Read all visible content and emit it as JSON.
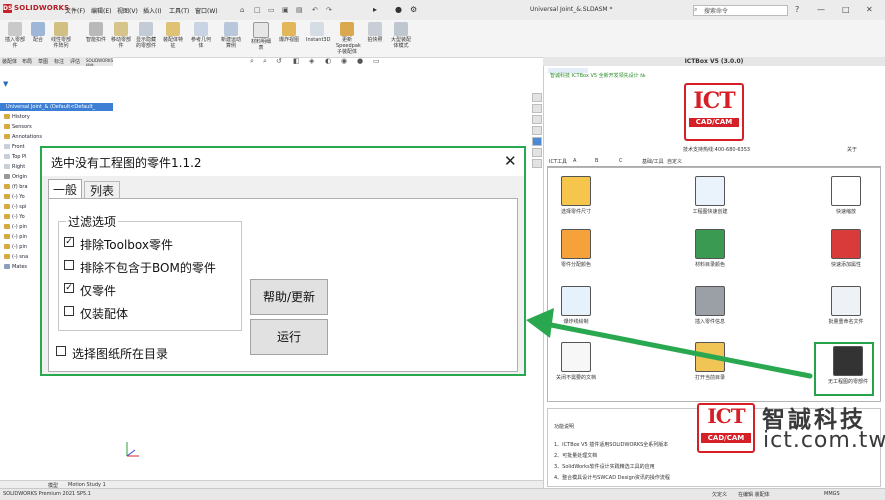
{
  "app": {
    "logo_text": "SOLIDWORKS",
    "menus": [
      "文件(F)",
      "编辑(E)",
      "视图(V)",
      "插入(I)",
      "工具(T)",
      "窗口(W)"
    ],
    "document_title": "Universal Joint_&.SLDASM *",
    "search_placeholder": "搜索命令",
    "window_controls": [
      "?",
      "—",
      "□",
      "✕"
    ]
  },
  "command_manager": {
    "labels": [
      "插入零部件",
      "配合",
      "线性零部件阵列",
      "智能扣件",
      "移动零部件",
      "显示隐藏的零部件",
      "装配体特征",
      "参考几何体",
      "新建运动算例",
      "材料明细表",
      "爆炸视图",
      "Instant3D",
      "更新Speedpak子装配体",
      "拍快照",
      "大型装配体模式"
    ]
  },
  "left_panel": {
    "tabs": [
      "装配体",
      "布局",
      "草图",
      "标注",
      "评估",
      "SOLIDWORKS 插件"
    ],
    "tree_root": "Universal Joint_& (Default<Default_",
    "tree_items": [
      "History",
      "Sensors",
      "Annotations",
      "Front",
      "Top Pl",
      "Right",
      "Origin",
      "(f) bra",
      "(-) Yo",
      "(-) spi",
      "(-) Yo",
      "(-) pin",
      "(-) pin",
      "(-) pin",
      "(-) sna",
      "Mates"
    ]
  },
  "ict_panel": {
    "header": "ICTBox V5 (3.0.0)",
    "subtitle": "智诚科技 ICTBox V5 全新开发领先设计 №",
    "logo_big": "ICT",
    "logo_bar": "CAD/CAM",
    "hotline": "技术支持热线:400-680-6353",
    "about": "关于",
    "tabs": [
      "ICT工具",
      "A",
      "B",
      "C",
      "基础/工具",
      "自定义"
    ],
    "tools": [
      {
        "label": "选择零件尺寸",
        "color": "#f5c64b",
        "icon": "dimension-icon"
      },
      {
        "label": "工程图快速创建",
        "color": "#eaf3fb",
        "icon": "document-gear-icon"
      },
      {
        "label": "快速缩放",
        "color": "#ffffff",
        "icon": "zoom-arrow-icon"
      },
      {
        "label": "零件分配颜色",
        "color": "#f6a23a",
        "icon": "rainbow-icon"
      },
      {
        "label": "材料目录颜色",
        "color": "#3b9a52",
        "icon": "blocks-icon"
      },
      {
        "label": "快速添加属性",
        "color": "#d93b3b",
        "icon": "properties-icon"
      },
      {
        "label": "爆炸线绘制",
        "color": "#e5f2fb",
        "icon": "explode-icon"
      },
      {
        "label": "插入零件信息",
        "color": "#9aa0a6",
        "icon": "part-info-icon"
      },
      {
        "label": "批量重命名文件",
        "color": "#eef2f7",
        "icon": "rename-icon"
      },
      {
        "label": "关闭不需要的文档",
        "color": "#f7f7f7",
        "icon": "close-doc-icon"
      },
      {
        "label": "打开当前目录",
        "color": "#f0c455",
        "icon": "folder-icon"
      },
      {
        "label": "无工程图的零部件",
        "color": "#333333",
        "icon": "no-drawing-icon"
      }
    ],
    "description_title": "功能说明",
    "description_lines": [
      "1、ICTBox V5 插件适用SOLIDWORKS全系列版本",
      "2、可批量处理文档",
      "3、SolidWorks软件设计实践精选工具的应用",
      "4、整合模具设计与SWCAD Design资讯的操作流程"
    ]
  },
  "watermark": {
    "logo_big": "ICT",
    "logo_bar": "CAD/CAM",
    "company_cn": "智誠科技",
    "url": "ict.com.tw"
  },
  "bottom_tabs": [
    "模型",
    "Motion Study 1"
  ],
  "status": {
    "version": "SOLIDWORKS Premium 2021 SP5.1",
    "mode": "欠定义",
    "edit": "在编辑 装配体",
    "units": "MMGS"
  },
  "dialog": {
    "title": "选中没有工程图的零件1.1.2",
    "tab_general": "一般",
    "tab_list": "列表",
    "group_label": "过滤选项",
    "options": [
      {
        "label": "排除Toolbox零件",
        "checked": true
      },
      {
        "label": "排除不包含于BOM的零件",
        "checked": false
      },
      {
        "label": "仅零件",
        "checked": true
      },
      {
        "label": "仅装配体",
        "checked": false
      }
    ],
    "select_folder_label": "选择图纸所在目录",
    "select_folder_checked": false,
    "help_button": "帮助/更新",
    "run_button": "运行",
    "close_symbol": "✕",
    "check_mark": "✓"
  },
  "colors": {
    "accent_green": "#2aa84f",
    "ict_red": "#d62027"
  }
}
